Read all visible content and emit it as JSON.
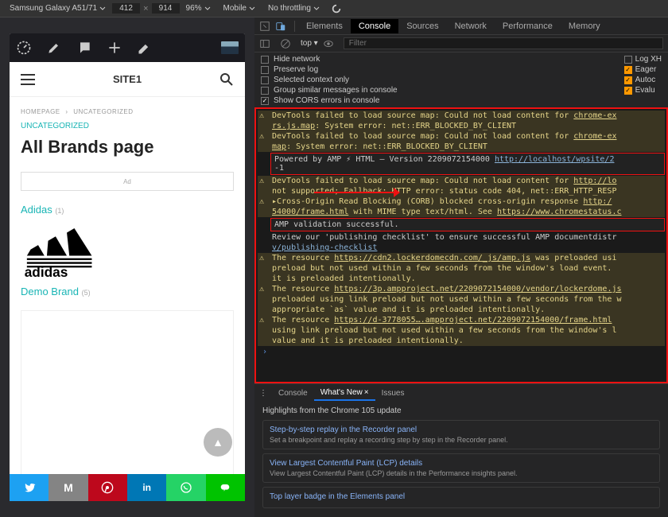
{
  "toolbar": {
    "device": "Samsung Galaxy A51/71",
    "width": "412",
    "height": "914",
    "zoom": "96%",
    "media": "Mobile",
    "throttle": "No throttling"
  },
  "site": {
    "title": "SITE1",
    "breadcrumb_home": "HOMEPAGE",
    "breadcrumb_cat": "UNCATEGORIZED",
    "category": "UNCATEGORIZED",
    "page_title": "All Brands page",
    "ad_label": "Ad",
    "brand1": "Adidas",
    "brand1_count": "(1)",
    "adidas_text": "adidas",
    "brand2": "Demo Brand",
    "brand2_count": "(5)",
    "scroll_top": "▲"
  },
  "devtools": {
    "tabs": [
      "Elements",
      "Console",
      "Sources",
      "Network",
      "Performance",
      "Memory"
    ],
    "active_tab": "Console",
    "top_scope": "top",
    "filter_placeholder": "Filter",
    "opts": {
      "hide_network": "Hide network",
      "preserve_log": "Preserve log",
      "selected_context": "Selected context only",
      "group_similar": "Group similar messages in console",
      "show_cors": "Show CORS errors in console",
      "log_xh": "Log XH",
      "eager": "Eager",
      "autoc": "Autoc",
      "evalu": "Evalu"
    }
  },
  "console_logs": {
    "l1a": "DevTools failed to load source map: Could not load content for ",
    "l1b": "chrome-ex",
    "l1c": "rs.js.map",
    "l1d": ": System error: net::ERR_BLOCKED_BY_CLIENT",
    "l2a": "DevTools failed to load source map: Could not load content for ",
    "l2b": "chrome-ex",
    "l2c": "map",
    "l2d": ": System error: net::ERR_BLOCKED_BY_CLIENT",
    "box1a": "Powered by AMP ⚡ HTML – Version 2209072154000 ",
    "box1b": "http://localhost/wpsite/2",
    "box1c": "-1",
    "l3a": "DevTools failed to load source map: Could not load content for ",
    "l3b": "http://lo",
    "l3c": " not supported; Fallback: HTTP error: status code 404, net::ERR_HTTP_RESP",
    "l4a": "Cross-Origin Read Blocking (CORB) blocked cross-origin response ",
    "l4b": "http:/",
    "l4c": "54000/frame.html",
    "l4d": " with MIME type text/html. See ",
    "l4e": "https://www.chromestatus.c",
    "box2": "AMP validation successful.",
    "l5a": "Review our 'publishing checklist' to ensure successful AMP documentdistr",
    "l5b": "v/publishing-checklist",
    "l6a": "The resource ",
    "l6b": "https://cdn2.lockerdomecdn.com/_js/amp.js",
    "l6c": " was preloaded usi",
    "l6d": "preload but not used within a few seconds from the window's load event.",
    "l6e": "it is preloaded intentionally.",
    "l7a": "The resource ",
    "l7b": "https://3p.ampproject.net/2209072154000/vendor/lockerdome.js",
    "l7c": "preloaded using link preload but not used within a few seconds from the w",
    "l7d": "appropriate `as` value and it is preloaded intentionally.",
    "l8a": "The resource ",
    "l8b": "https://d-3778055….ampproject.net/2209072154000/frame.html",
    "l8c": "using link preload but not used within a few seconds from the window's l",
    "l8d": "value and it is preloaded intentionally."
  },
  "drawer": {
    "tabs": [
      "Console",
      "What's New",
      "Issues"
    ],
    "active": "What's New",
    "highlight": "Highlights from the Chrome 105 update",
    "tips": [
      {
        "title": "Step-by-step replay in the Recorder panel",
        "desc": "Set a breakpoint and replay a recording step by step in the Recorder panel."
      },
      {
        "title": "View Largest Contentful Paint (LCP) details",
        "desc": "View Largest Contentful Paint (LCP) details in the Performance insights panel."
      },
      {
        "title": "Top layer badge in the Elements panel",
        "desc": ""
      }
    ]
  }
}
